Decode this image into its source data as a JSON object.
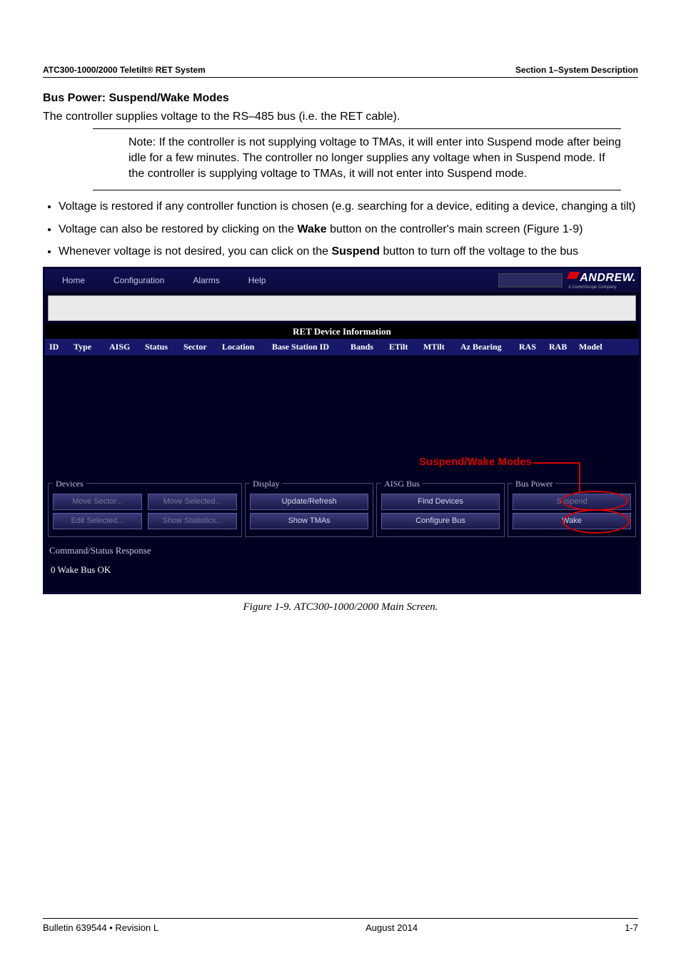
{
  "header": {
    "left": "ATC300-1000/2000 Teletilt® RET System",
    "right": "Section 1–System Description"
  },
  "section": {
    "title": "Bus Power: Suspend/Wake Modes",
    "intro": "The controller supplies voltage to the RS–485 bus (i.e. the RET cable).",
    "note": "Note: If the controller is not supplying voltage to TMAs, it will enter into Suspend mode after being idle for a few minutes. The controller no longer supplies any voltage when in Suspend mode. If the controller is supplying voltage to TMAs, it will not enter into Suspend mode.",
    "bullets": {
      "b1": "Voltage is restored if any controller function is chosen (e.g. searching for a device, editing a device, changing a tilt)",
      "b2_pre": "Voltage can also be restored by clicking on the ",
      "b2_b": "Wake",
      "b2_post": " button on the controller's main screen (Figure 1-9)",
      "b3_pre": "Whenever voltage is not desired, you can click on the ",
      "b3_b": "Suspend",
      "b3_post": " button to turn off the voltage to the bus"
    }
  },
  "app": {
    "menu": {
      "home": "Home",
      "config": "Configuration",
      "alarms": "Alarms",
      "help": "Help"
    },
    "brand": {
      "name": "ANDREW.",
      "sub": "A CommScope Company"
    },
    "grid_title": "RET Device Information",
    "cols": {
      "id": "ID",
      "type": "Type",
      "aisg": "AISG",
      "status": "Status",
      "sector": "Sector",
      "location": "Location",
      "bsid": "Base Station ID",
      "bands": "Bands",
      "etilt": "ETilt",
      "mtilt": "MTilt",
      "azb": "Az Bearing",
      "ras": "RAS",
      "rab": "RAB",
      "model": "Model"
    },
    "callout": {
      "sw": "Suspend/Wake",
      "modes": " Modes"
    },
    "groups": {
      "devices": {
        "legend": "Devices",
        "move_sector": "Move Sector...",
        "edit_selected": "Edit Selected...",
        "move_selected": "Move Selected...",
        "show_stats": "Show Statistics..."
      },
      "display": {
        "legend": "Display",
        "update": "Update/Refresh",
        "show_tmas": "Show TMAs"
      },
      "aisgbus": {
        "legend": "AISG Bus",
        "find": "Find Devices",
        "config": "Configure Bus"
      },
      "buspower": {
        "legend": "Bus Power",
        "suspend": "Suspend",
        "wake": "Wake"
      }
    },
    "cmd": {
      "title": "Command/Status Response",
      "body": "0 Wake Bus OK"
    }
  },
  "figcaption": "Figure 1-9.  ATC300-1000/2000 Main Screen.",
  "footer": {
    "left": "Bulletin 639544  •  Revision L",
    "center": "August 2014",
    "right": "1-7"
  }
}
